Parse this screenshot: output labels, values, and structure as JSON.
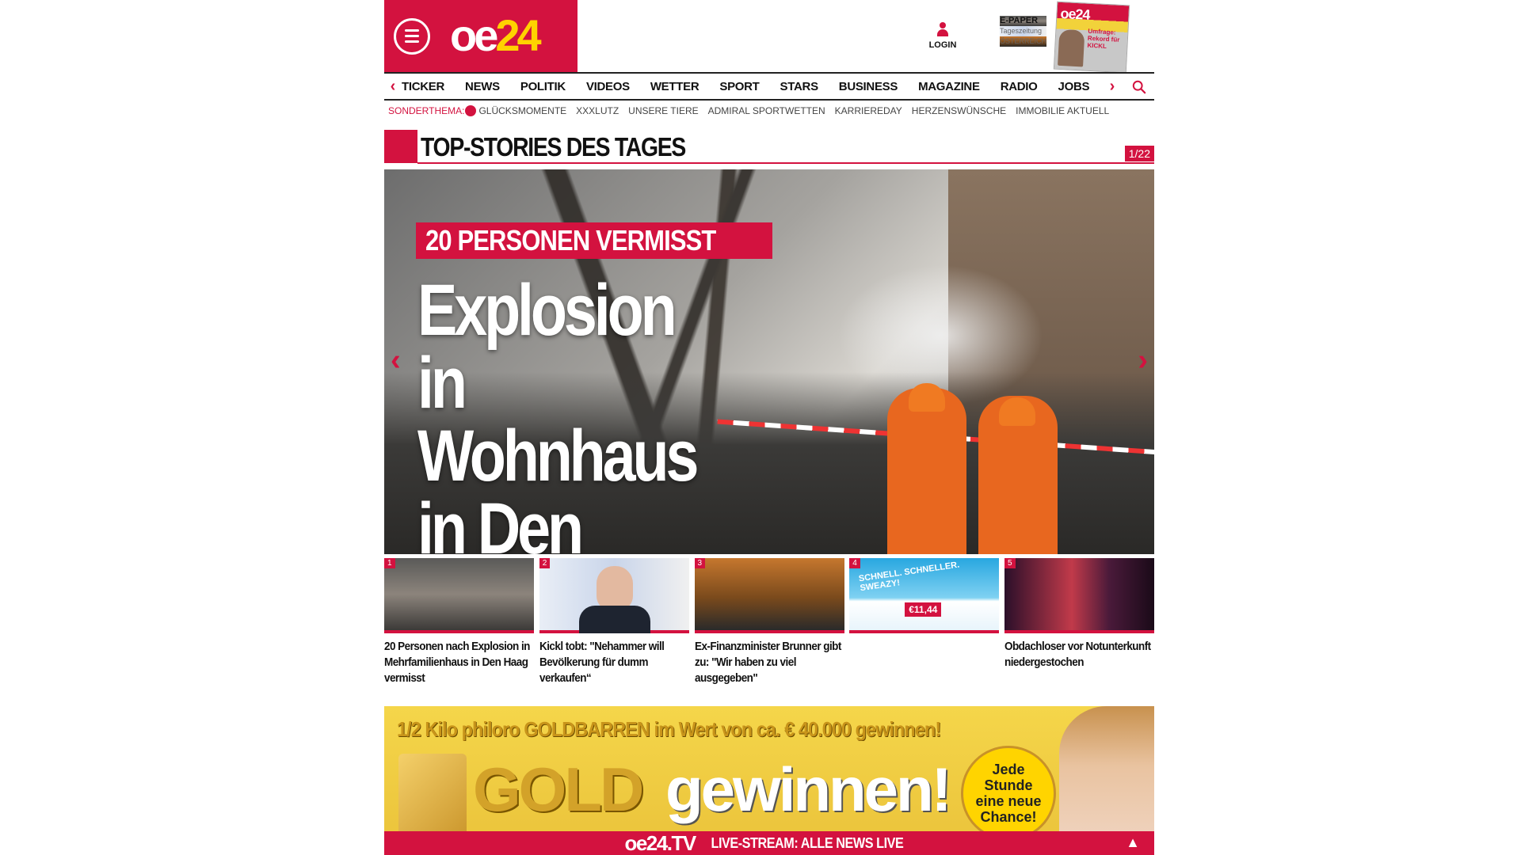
{
  "header": {
    "logo": {
      "part1": "oe",
      "part2": "24"
    },
    "login_label": "LOGIN",
    "epaper": {
      "title": "E-PAPER",
      "line2": "Tageszeitung",
      "line3": "ÖSTERREICH"
    },
    "cover": {
      "masthead": "oe24",
      "headline": "Umfrage: Rekord für KICKL"
    }
  },
  "nav": {
    "items": [
      "TICKER",
      "NEWS",
      "POLITIK",
      "VIDEOS",
      "WETTER",
      "SPORT",
      "STARS",
      "BUSINESS",
      "MAGAZINE",
      "RADIO",
      "JOBS"
    ],
    "left_arrow": "‹",
    "right_arrow": "›"
  },
  "subnav": {
    "label": "SONDERTHEMA:",
    "items": [
      "GLÜCKSMOMENTE",
      "XXXLUTZ",
      "UNSERE TIERE",
      "ADMIRAL SPORTWETTEN",
      "KARRIEREDAY",
      "HERZENSWÜNSCHE",
      "IMMOBILIE AKTUELL"
    ]
  },
  "section": {
    "title": "TOP-STORIES DES TAGES",
    "counter": "1/22"
  },
  "hero": {
    "kicker": "20 PERSONEN VERMISST",
    "headline": "Explosion in Wohnhaus in Den Haag"
  },
  "thumbs": [
    {
      "num": "1",
      "caption": "20 Personen nach Explosion in Mehrfamilienhaus in Den Haag vermisst"
    },
    {
      "num": "2",
      "caption": "Kickl tobt: \"Nehammer will Bevölkerung für dumm verkaufen“"
    },
    {
      "num": "3",
      "caption": "Ex-Finanzminister Brunner gibt zu: \"Wir haben zu viel ausgegeben\""
    },
    {
      "num": "4",
      "caption": "",
      "ad_text": "SCHNELL. SCHNELLER. SWEAZY!",
      "ad_price": "€11,44"
    },
    {
      "num": "5",
      "caption": "Obdachloser vor Notunterkunft niedergestochen"
    }
  ],
  "banner": {
    "top_line": "1/2 Kilo philoro GOLDBARREN im Wert von ca. € 40.000 gewinnen!",
    "gold": "GOLD",
    "gewinnen": "gewinnen!",
    "badge": "Jede Stunde eine neue Chance!"
  },
  "live": {
    "logo": "oe24.TV",
    "text": "LIVE-STREAM: ALLE NEWS LIVE",
    "up": "▲"
  },
  "colors": {
    "brand_red": "#d3123f",
    "brand_yellow": "#ffd200"
  }
}
